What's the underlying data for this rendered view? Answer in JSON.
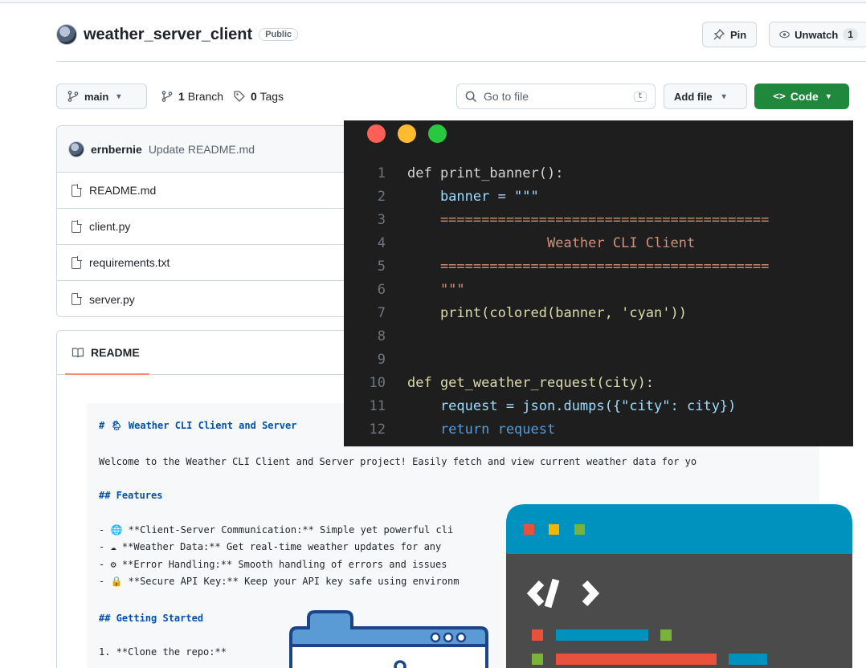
{
  "repo": {
    "name": "weather_server_client",
    "visibility": "Public"
  },
  "actions": {
    "pin": "Pin",
    "unwatch": "Unwatch",
    "unwatch_count": "1"
  },
  "branch_bar": {
    "branch": "main",
    "branches_count": "1",
    "branches_label": "Branch",
    "tags_count": "0",
    "tags_label": "Tags",
    "search_placeholder": "Go to file",
    "search_shortcut": "t",
    "add_file": "Add file",
    "code": "Code"
  },
  "latest_commit": {
    "author": "ernbernie",
    "message": "Update README.md"
  },
  "files": [
    {
      "name": "README.md"
    },
    {
      "name": "client.py"
    },
    {
      "name": "requirements.txt"
    },
    {
      "name": "server.py"
    }
  ],
  "readme": {
    "tab": "README",
    "lines": [
      "# 🌦 Weather CLI Client and Server",
      "Welcome to the Weather CLI Client and Server project! Easily fetch and view current weather data for yo",
      "## Features",
      "- 🌐 **Client-Server Communication:** Simple yet powerful cli",
      "- ☁ **Weather Data:** Get real-time weather updates for any",
      "- ⚙ **Error Handling:** Smooth handling of errors and issues",
      "- 🔒 **Secure API Key:** Keep your API key safe using environm",
      "## Getting Started",
      "1. **Clone the repo:**"
    ]
  },
  "code_window": {
    "dot_colors": [
      "#ff5f57",
      "#febc2e",
      "#28c840"
    ],
    "lines": [
      {
        "n": "1",
        "text": "def print_banner():"
      },
      {
        "n": "2",
        "text": "    banner = \"\"\""
      },
      {
        "n": "3",
        "text": "    ========================================"
      },
      {
        "n": "4",
        "text": "                 Weather CLI Client"
      },
      {
        "n": "5",
        "text": "    ========================================"
      },
      {
        "n": "6",
        "text": "    \"\"\""
      },
      {
        "n": "7",
        "text": "    print(colored(banner, 'cyan'))"
      },
      {
        "n": "8",
        "text": ""
      },
      {
        "n": "9",
        "text": ""
      },
      {
        "n": "10",
        "text": "def get_weather_request(city):"
      },
      {
        "n": "11",
        "text": "    request = json.dumps({\"city\": city})"
      },
      {
        "n": "12",
        "text": "    return request"
      }
    ]
  },
  "colors": {
    "primary_green": "#1f883d",
    "illus_blue": "#0092bf",
    "illus_dark": "#4b4b4b"
  }
}
